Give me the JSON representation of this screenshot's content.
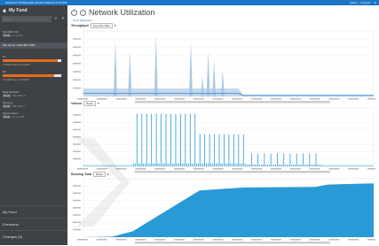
{
  "header": {
    "app_title": "DEFAULT WIRELESS MONITORING SYSTEM",
    "user": "Admin",
    "account": "Account"
  },
  "sidebar": {
    "title": "My Fund",
    "search_placeholder": "Search",
    "nodes": [
      {
        "name": "192.168.1.63",
        "value": "10.1.0.84"
      },
      {
        "name": "Data Network",
        "value": "192.168.1.5"
      },
      {
        "name": "Server 2",
        "value": "192.168.1.7"
      },
      {
        "name": "Server Room",
        "value": "10.1.1.220"
      }
    ],
    "group_label": "File Server (192.168.1.196)",
    "disks": [
      {
        "name": "C:\\",
        "pct": 0.94,
        "label": "1.08GB free of 31.9GB"
      },
      {
        "name": "D:\\",
        "pct": 0.88,
        "label": "10.2GB free of 200GB"
      }
    ],
    "bottom": [
      "My Fund",
      "Evensend",
      "Changes (0)"
    ]
  },
  "main": {
    "title": "Network Utilization",
    "links": [
      "Send ⊞ Refresh"
    ],
    "panels": [
      {
        "label": "Throughput",
        "select": "Avg, Min, Max"
      },
      {
        "label": "Volume",
        "select": "Bytes"
      },
      {
        "label": "Running Total",
        "select": "Bytes"
      }
    ],
    "colors": {
      "accent": "#1b76c5",
      "area": "#2a9ad6",
      "light": "#c3d8ec"
    }
  }
}
